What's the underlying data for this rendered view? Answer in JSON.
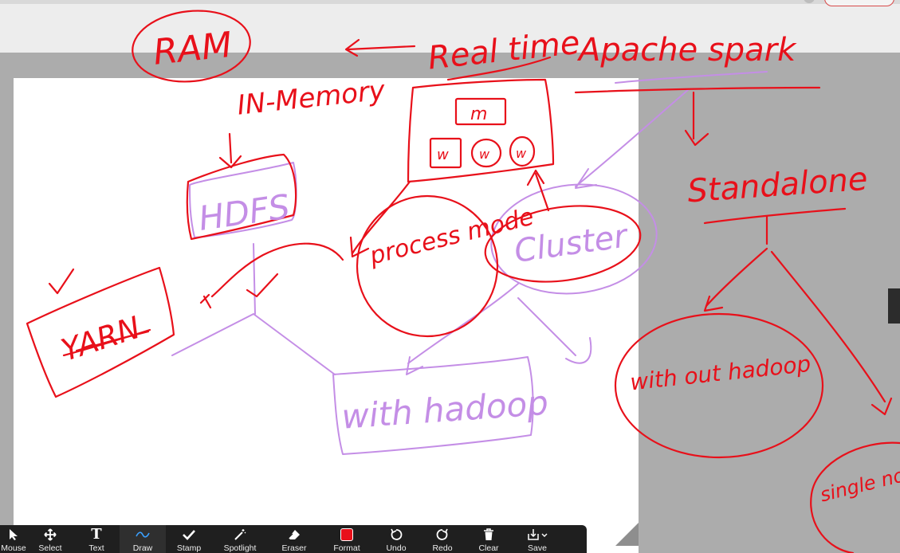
{
  "board": {
    "labels": {
      "ram": "RAM",
      "realtime": "Real time",
      "apache_spark": "Apache spark",
      "in_memory": "IN-Memory",
      "master": "m",
      "worker": "w",
      "hdfs": "HDFS",
      "yarn": "YARN",
      "process_mode": "process mode",
      "cluster": "Cluster",
      "with_hadoop": "with hadoop",
      "standalone": "Standalone",
      "without_hadoop": "with out hadoop",
      "single_node": "single node"
    }
  },
  "toolbar": {
    "items": [
      {
        "label": "Mouse",
        "icon": "cursor-icon"
      },
      {
        "label": "Select",
        "icon": "move-icon"
      },
      {
        "label": "Text",
        "icon": "text-icon"
      },
      {
        "label": "Draw",
        "icon": "draw-icon"
      },
      {
        "label": "Stamp",
        "icon": "check-icon"
      },
      {
        "label": "Spotlight",
        "icon": "wand-icon"
      },
      {
        "label": "Eraser",
        "icon": "eraser-icon"
      },
      {
        "label": "Format",
        "icon": "color-swatch-icon"
      },
      {
        "label": "Undo",
        "icon": "undo-icon"
      },
      {
        "label": "Redo",
        "icon": "redo-icon"
      },
      {
        "label": "Clear",
        "icon": "trash-icon"
      },
      {
        "label": "Save",
        "icon": "save-icon"
      }
    ],
    "active": "Draw",
    "format_color": "#e8101a"
  },
  "colors": {
    "red_ink": "#e8101a",
    "purple_ink": "#c48ee6"
  }
}
